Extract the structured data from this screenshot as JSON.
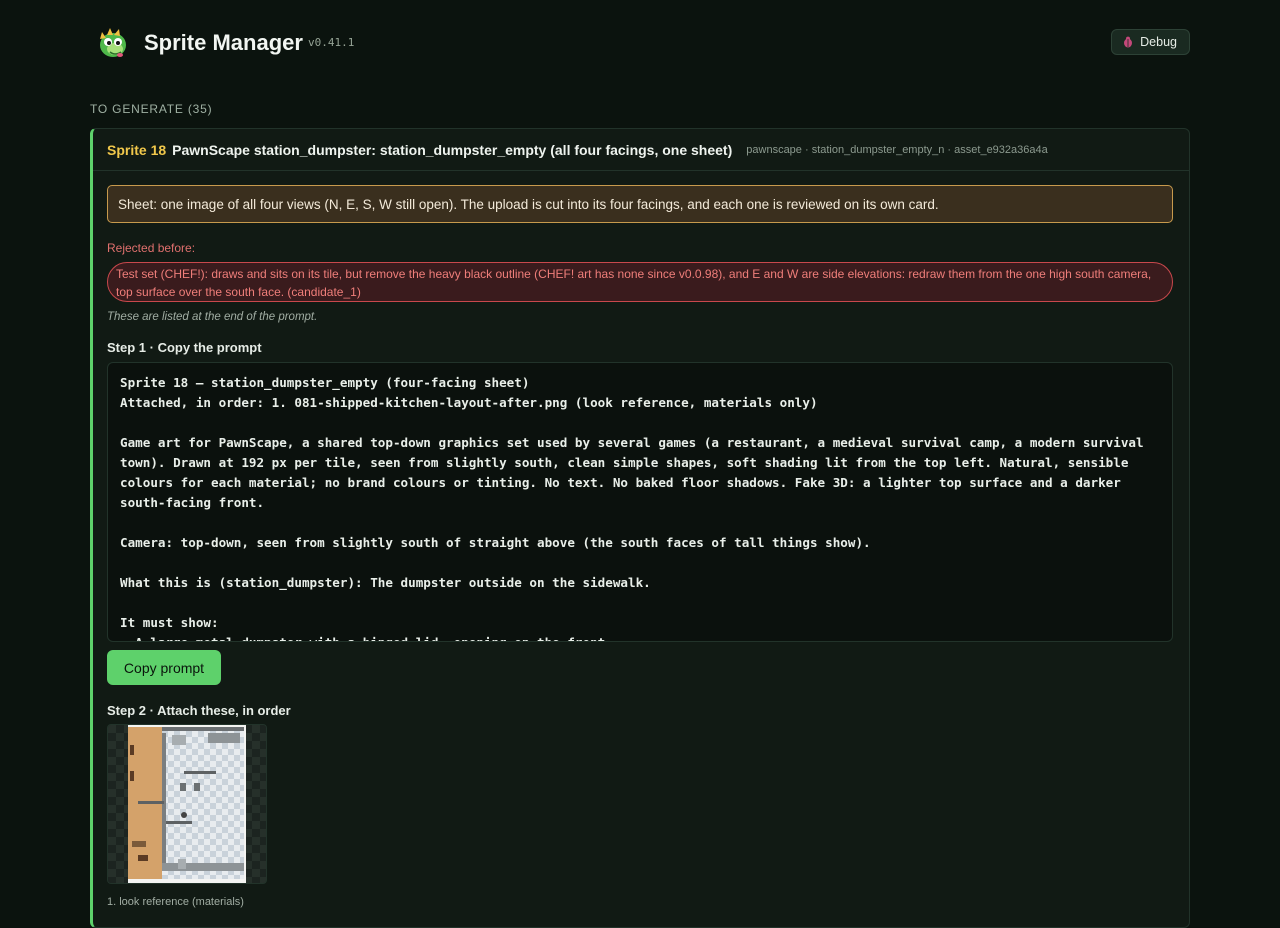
{
  "app": {
    "title": "Sprite Manager",
    "version": "v0.41.1",
    "debug_label": "Debug"
  },
  "section": {
    "heading": "TO GENERATE (35)"
  },
  "card": {
    "sprite_num": "Sprite 18",
    "title": "PawnScape station_dumpster: station_dumpster_empty (all four facings, one sheet)",
    "meta": "pawnscape · station_dumpster_empty_n · asset_e932a36a4a",
    "sheet_note": "Sheet: one image of all four views (N, E, S, W still open). The upload is cut into its four facings, and each one is reviewed on its own card.",
    "rejected_label": "Rejected before:",
    "rejected_text": "Test set (CHEF!): draws and sits on its tile, but remove the heavy black outline (CHEF! art has none since v0.0.98), and E and W are side elevations: redraw them from the one high south camera, top surface over the south face. (candidate_1)",
    "rejected_note": "These are listed at the end of the prompt.",
    "step1_label": "Step 1 · Copy the prompt",
    "prompt": "Sprite 18 — station_dumpster_empty (four-facing sheet)\nAttached, in order: 1. 081-shipped-kitchen-layout-after.png (look reference, materials only)\n\nGame art for PawnScape, a shared top-down graphics set used by several games (a restaurant, a medieval survival camp, a modern survival town). Drawn at 192 px per tile, seen from slightly south, clean simple shapes, soft shading lit from the top left. Natural, sensible colours for each material; no brand colours or tinting. No text. No baked floor shadows. Fake 3D: a lighter top surface and a darker south-facing front.\n\nCamera: top-down, seen from slightly south of straight above (the south faces of tall things show).\n\nWhat this is (station_dumpster): The dumpster outside on the sidewalk.\n\nIt must show:\n- A large metal dumpster with a hinged lid, opening on the front",
    "copy_label": "Copy prompt",
    "step2_label": "Step 2 · Attach these, in order",
    "attachment_caption": "1. look reference (materials)"
  },
  "colors": {
    "accent": "#5ed16b",
    "sprite_num": "#f1c84b",
    "reject": "#ef7e7a",
    "note_border": "#c79a4d"
  },
  "icons": {
    "logo": "dragon-logo-icon",
    "debug": "bug-icon"
  }
}
